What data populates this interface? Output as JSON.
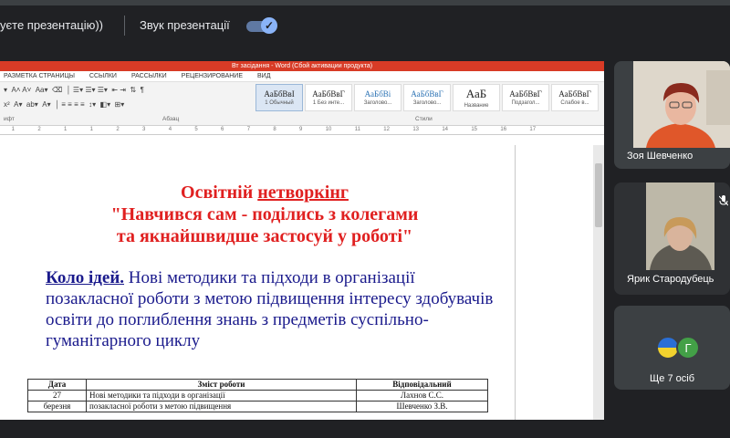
{
  "topbar": {
    "presenting_text": "уєте презентацію))",
    "sound_label": "Звук презентації",
    "sound_toggle_on": true
  },
  "word": {
    "title": "Вт засідання - Word (Сбой активации продукта)",
    "tabs": [
      "РАЗМЕТКА СТРАНИЦЫ",
      "ССЫЛКИ",
      "РАССЫЛКИ",
      "РЕЦЕНЗИРОВАНИЕ",
      "ВИД"
    ],
    "group_labels": {
      "font": "ифт",
      "paragraph": "Абзац",
      "styles": "Стили"
    },
    "styles": [
      {
        "sample": "АаБбВвІ",
        "name": "1 Обычный"
      },
      {
        "sample": "АаБбВвГ",
        "name": "1 Без инте..."
      },
      {
        "sample": "АаБбВі",
        "name": "Заголово..."
      },
      {
        "sample": "АаБбВвГ",
        "name": "Заголово..."
      },
      {
        "sample": "АаБ",
        "name": "Название"
      },
      {
        "sample": "АаБбВвГ",
        "name": "Подзагол..."
      },
      {
        "sample": "АаБбВвГ",
        "name": "Слабое в..."
      }
    ],
    "ruler": [
      "1",
      "2",
      "1",
      "1",
      "2",
      "3",
      "4",
      "5",
      "6",
      "7",
      "8",
      "9",
      "10",
      "11",
      "12",
      "13",
      "14",
      "15",
      "16",
      "17"
    ]
  },
  "document": {
    "heading_line1_prefix": "Освітній ",
    "heading_line1_underlined": "нетворкінг",
    "heading_line2": "\"Навчився сам - поділись з колегами",
    "heading_line3": "та якнайшвидше застосуй у роботі\"",
    "para_label": "Коло ідей.",
    "para_text": " Нові методики та підходи в організації позакласної роботи з метою підвищення інтересу здобувачів освіти до поглиблення знань з предметів суспільно-гуманітарного циклу",
    "table": {
      "headers": [
        "Дата",
        "Зміст роботи",
        "Відповідальний"
      ],
      "rows": [
        {
          "date": "27",
          "content": "Нові методики та підходи в організації",
          "responsible": "Лахнов С.С."
        },
        {
          "date": "березня",
          "content": "позакласної роботи з метою підвищення",
          "responsible": "Шевченко З.В."
        }
      ]
    }
  },
  "participants": [
    {
      "name": "Зоя Шевченко"
    },
    {
      "name": "Ярик Стародубець"
    }
  ],
  "more_tile": {
    "avatar_letter": "Г",
    "label": "Ще 7 осіб"
  }
}
